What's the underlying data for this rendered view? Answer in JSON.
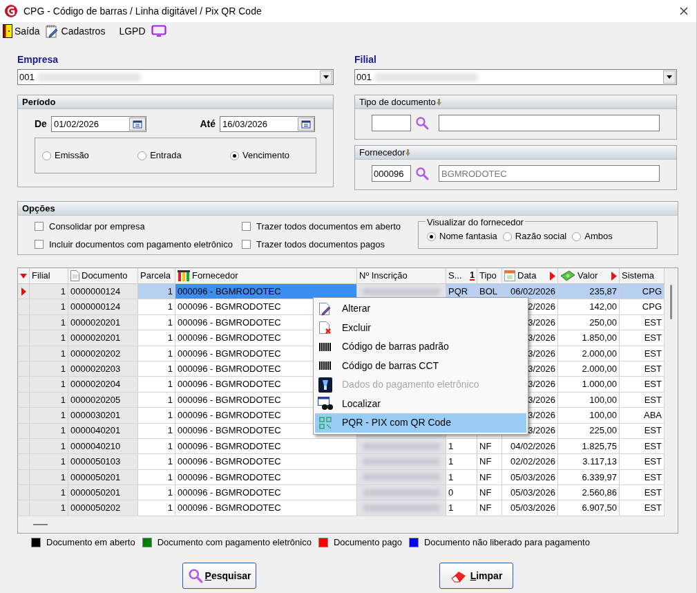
{
  "window": {
    "title": "CPG - Código de barras / Linha digitável / Pix QR Code"
  },
  "toolbar": [
    {
      "label": "Saída",
      "kind": "exit"
    },
    {
      "label": "Cadastros",
      "kind": "register"
    },
    {
      "label": "LGPD",
      "kind": "privacy"
    }
  ],
  "empresa": {
    "label": "Empresa",
    "value": "001"
  },
  "filial": {
    "label": "Filial",
    "value": "001"
  },
  "periodo": {
    "title": "Período",
    "de": {
      "label": "De",
      "value": "01/02/2026"
    },
    "ate": {
      "label": "Até",
      "value": "16/03/2026"
    },
    "radios": [
      {
        "label": "Emissão",
        "selected": false
      },
      {
        "label": "Entrada",
        "selected": false
      },
      {
        "label": "Vencimento",
        "selected": true
      }
    ]
  },
  "tipo_documento": {
    "title": "Tipo de documento"
  },
  "fornecedor": {
    "title": "Fornecedor",
    "code": "000096",
    "name": "BGMRODOTEC"
  },
  "opcoes": {
    "title": "Opções",
    "checkboxes": [
      {
        "label": "Consolidar por empresa",
        "checked": false
      },
      {
        "label": "Incluir documentos com pagamento eletrônico",
        "checked": false
      },
      {
        "label": "Trazer todos documentos em aberto",
        "checked": false
      },
      {
        "label": "Trazer todos documentos pagos",
        "checked": false
      }
    ],
    "visualizar": {
      "title": "Visualizar do fornecedor",
      "radios": [
        {
          "label": "Nome fantasia",
          "selected": true
        },
        {
          "label": "Razão social",
          "selected": false
        },
        {
          "label": "Ambos",
          "selected": false
        }
      ]
    }
  },
  "table": {
    "columns": [
      {
        "label": "Filial",
        "kind": "plain"
      },
      {
        "label": "Documento",
        "kind": "document"
      },
      {
        "label": "Parcela",
        "kind": "plain"
      },
      {
        "label": "Fornecedor",
        "kind": "supplier"
      },
      {
        "label": "Nº Inscrição",
        "kind": "plain"
      },
      {
        "label": "S...",
        "kind": "sorted",
        "sort": "1"
      },
      {
        "label": "Tipo",
        "kind": "plain"
      },
      {
        "label": "Data",
        "kind": "date"
      },
      {
        "label": "Valor",
        "kind": "money"
      },
      {
        "label": "Sistema",
        "kind": "plain"
      }
    ],
    "rows": [
      {
        "selected": true,
        "filial": "1",
        "documento": "0000000124",
        "parcela": "1",
        "fornecedor": "000096 - BGMRODOTEC",
        "s": "PQR",
        "tipo": "BOL",
        "data": "06/02/2026",
        "valor": "235,87",
        "sistema": "CPG"
      },
      {
        "selected": false,
        "filial": "1",
        "documento": "0000000124",
        "parcela": "1",
        "fornecedor": "000096 - BGMRODOTEC",
        "data": "2/2026",
        "valor": "142,00",
        "sistema": "CPG"
      },
      {
        "selected": false,
        "filial": "1",
        "documento": "0000020201",
        "parcela": "1",
        "fornecedor": "000096 - BGMRODOTEC",
        "data": "3/2026",
        "valor": "250,00",
        "sistema": "EST"
      },
      {
        "selected": false,
        "filial": "1",
        "documento": "0000020201",
        "parcela": "1",
        "fornecedor": "000096 - BGMRODOTEC",
        "data": "3/2026",
        "valor": "1.850,00",
        "sistema": "EST"
      },
      {
        "selected": false,
        "filial": "1",
        "documento": "0000020202",
        "parcela": "1",
        "fornecedor": "000096 - BGMRODOTEC",
        "data": "3/2026",
        "valor": "2.000,00",
        "sistema": "EST"
      },
      {
        "selected": false,
        "filial": "1",
        "documento": "0000020203",
        "parcela": "1",
        "fornecedor": "000096 - BGMRODOTEC",
        "data": "3/2026",
        "valor": "2.000,00",
        "sistema": "EST"
      },
      {
        "selected": false,
        "filial": "1",
        "documento": "0000020204",
        "parcela": "1",
        "fornecedor": "000096 - BGMRODOTEC",
        "data": "3/2026",
        "valor": "1.000,00",
        "sistema": "EST"
      },
      {
        "selected": false,
        "filial": "1",
        "documento": "0000020205",
        "parcela": "1",
        "fornecedor": "000096 - BGMRODOTEC",
        "data": "3/2026",
        "valor": "100,00",
        "sistema": "EST"
      },
      {
        "selected": false,
        "filial": "1",
        "documento": "0000030201",
        "parcela": "1",
        "fornecedor": "000096 - BGMRODOTEC",
        "data": "3/2026",
        "valor": "100,00",
        "sistema": "ABA"
      },
      {
        "selected": false,
        "filial": "1",
        "documento": "0000040201",
        "parcela": "1",
        "fornecedor": "000096 - BGMRODOTEC",
        "data": "3/2026",
        "valor": "225,00",
        "sistema": "EST"
      },
      {
        "selected": false,
        "filial": "1",
        "documento": "0000040210",
        "parcela": "1",
        "fornecedor": "000096 - BGMRODOTEC",
        "s": "1",
        "tipo": "NF",
        "data": "04/02/2026",
        "valor": "1.825,75",
        "sistema": "EST"
      },
      {
        "selected": false,
        "filial": "1",
        "documento": "0000050103",
        "parcela": "1",
        "fornecedor": "000096 - BGMRODOTEC",
        "s": "1",
        "tipo": "NF",
        "data": "02/02/2026",
        "valor": "3.117,13",
        "sistema": "EST"
      },
      {
        "selected": false,
        "filial": "1",
        "documento": "0000050201",
        "parcela": "1",
        "fornecedor": "000096 - BGMRODOTEC",
        "s": "1",
        "tipo": "NF",
        "data": "05/03/2026",
        "valor": "6.339,97",
        "sistema": "EST"
      },
      {
        "selected": false,
        "filial": "1",
        "documento": "0000050201",
        "parcela": "1",
        "fornecedor": "000096 - BGMRODOTEC",
        "s": "0",
        "tipo": "NF",
        "data": "05/03/2026",
        "valor": "2.560,86",
        "sistema": "EST"
      },
      {
        "selected": false,
        "filial": "1",
        "documento": "0000050202",
        "parcela": "1",
        "fornecedor": "000096 - BGMRODOTEC",
        "s": "1",
        "tipo": "NF",
        "data": "05/03/2026",
        "valor": "6.907,50",
        "sistema": "EST"
      }
    ]
  },
  "context_menu": [
    {
      "label": "Alterar",
      "kind": "edit",
      "disabled": false,
      "selected": false
    },
    {
      "label": "Excluir",
      "kind": "delete",
      "disabled": false,
      "selected": false
    },
    {
      "label": "Código de barras padrão",
      "kind": "barcode",
      "disabled": false,
      "selected": false
    },
    {
      "label": "Código de barras CCT",
      "kind": "barcode",
      "disabled": false,
      "selected": false
    },
    {
      "label": "Dados do pagamento eletrônico",
      "kind": "payment",
      "disabled": true,
      "selected": false
    },
    {
      "label": "Localizar",
      "kind": "find",
      "disabled": false,
      "selected": false
    },
    {
      "label": "PQR - PIX com QR Code",
      "kind": "qr",
      "disabled": false,
      "selected": true
    }
  ],
  "legend": [
    {
      "label": "Documento em aberto",
      "color": "#000000"
    },
    {
      "label": "Documento com pagamento eletrônico",
      "color": "#008000"
    },
    {
      "label": "Documento pago",
      "color": "#ff0000"
    },
    {
      "label": "Documento não liberado para pagamento",
      "color": "#0000ff"
    }
  ],
  "buttons": [
    {
      "label": "Pesquisar",
      "kind": "search"
    },
    {
      "label": "Limpar",
      "kind": "clear"
    }
  ]
}
